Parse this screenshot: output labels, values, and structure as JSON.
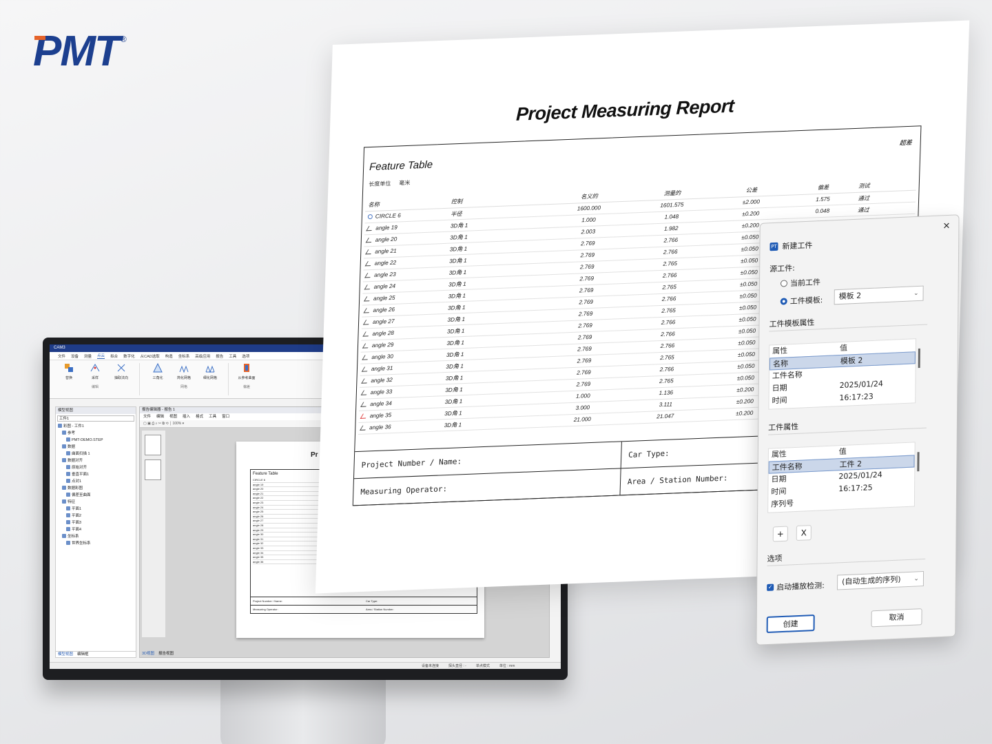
{
  "brand": {
    "name": "PMT",
    "reg": "®",
    "color": "#1c3f8f",
    "accent": "#e5632a"
  },
  "monitor": {
    "app_title": "CAM3",
    "menu": [
      "文件",
      "设备",
      "测量",
      "点云",
      "拟合",
      "数字化",
      "从CAD选取",
      "构造",
      "坐标系",
      "高级应用",
      "报告",
      "工具",
      "选项"
    ],
    "ribbon": {
      "group1": {
        "items": [
          "替换",
          "采样",
          "抽取法向"
        ],
        "label": "编辑"
      },
      "group2": {
        "items": [
          "三角化",
          "简化网格",
          "细化网格"
        ],
        "label": "网格"
      },
      "group3": {
        "items": [
          "从参考曲面"
        ],
        "label": "偏差"
      }
    },
    "left_panel": {
      "title": "模型视图",
      "select": "工件1",
      "tree": [
        "彩图 - 工件1",
        "参考",
        "PMT-DEMO.STEP",
        "数据",
        "曲面扫描 1",
        "数据对齐",
        "原始对齐",
        "垂直平面1",
        "点对1",
        "数据彩图",
        "偏差至曲面",
        "特征",
        "平面1",
        "平面2",
        "平面3",
        "平面4",
        "坐标系",
        "世界坐标系"
      ],
      "tabs": [
        "模型视图",
        "编辑框"
      ]
    },
    "report_editor": {
      "title": "报告编辑器 - 报告 1",
      "menu": [
        "文件",
        "编辑",
        "视图",
        "插入",
        "格式",
        "工具",
        "窗口"
      ],
      "zoom": "100%",
      "mini_heading": "Pr",
      "mini_table_title": "Feature Table",
      "mini_rows": [
        "CIRCLE 6",
        "angle 19",
        "angle 20",
        "angle 21",
        "angle 22",
        "angle 23",
        "angle 24",
        "angle 25",
        "angle 26",
        "angle 27",
        "angle 28",
        "angle 29",
        "angle 30",
        "angle 31",
        "angle 32",
        "angle 33",
        "angle 34",
        "angle 35",
        "angle 36"
      ],
      "mini_foot": [
        "Project Number / Name:",
        "Car Type:",
        "Measuring Operator:",
        "Area / Station Number:"
      ],
      "tabs": [
        "3D视图",
        "报告视图"
      ]
    },
    "status": [
      "设备未连接",
      "探头直径 : -",
      "单点模式",
      "单位 : mm"
    ]
  },
  "report": {
    "title": "Project Measuring Report",
    "table_title": "Feature Table",
    "unit_label": "长度单位",
    "unit_value": "毫米",
    "over_label": "超差",
    "headers": [
      "名称",
      "控制",
      "名义的",
      "测量的",
      "公差",
      "偏差",
      "测试"
    ],
    "rows": [
      {
        "name": "CIRCLE 6",
        "ctrl": "半径",
        "nom": "1600.000",
        "meas": "1601.575",
        "tol": "±2.000",
        "dev": "1.575",
        "test": "通过",
        "icon": "circle"
      },
      {
        "name": "angle 19",
        "ctrl": "3D角 1",
        "nom": "1.000",
        "meas": "1.048",
        "tol": "±0.200",
        "dev": "0.048",
        "test": "通过",
        "icon": "angle"
      },
      {
        "name": "angle 20",
        "ctrl": "3D角 1",
        "nom": "2.003",
        "meas": "1.982",
        "tol": "±0.200",
        "dev": "-0.021",
        "test": "通过",
        "icon": "angle"
      },
      {
        "name": "angle 21",
        "ctrl": "3D角 1",
        "nom": "2.769",
        "meas": "2.766",
        "tol": "±0.050",
        "dev": "-0.003",
        "test": "通过",
        "icon": "angle"
      },
      {
        "name": "angle 22",
        "ctrl": "3D角 1",
        "nom": "2.769",
        "meas": "2.766",
        "tol": "±0.050",
        "dev": "-0.003",
        "test": "通过",
        "icon": "angle"
      },
      {
        "name": "angle 23",
        "ctrl": "3D角 1",
        "nom": "2.769",
        "meas": "2.765",
        "tol": "±0.050",
        "dev": "-0.004",
        "test": "",
        "icon": "angle"
      },
      {
        "name": "angle 24",
        "ctrl": "3D角 1",
        "nom": "2.769",
        "meas": "2.766",
        "tol": "±0.050",
        "dev": "-0.003",
        "test": "",
        "icon": "angle"
      },
      {
        "name": "angle 25",
        "ctrl": "3D角 1",
        "nom": "2.769",
        "meas": "2.765",
        "tol": "±0.050",
        "dev": "-0.004",
        "test": "",
        "icon": "angle"
      },
      {
        "name": "angle 26",
        "ctrl": "3D角 1",
        "nom": "2.769",
        "meas": "2.766",
        "tol": "±0.050",
        "dev": "-0.003",
        "test": "",
        "icon": "angle"
      },
      {
        "name": "angle 27",
        "ctrl": "3D角 1",
        "nom": "2.769",
        "meas": "2.765",
        "tol": "±0.050",
        "dev": "-0.004",
        "test": "",
        "icon": "angle"
      },
      {
        "name": "angle 28",
        "ctrl": "3D角 1",
        "nom": "2.769",
        "meas": "2.766",
        "tol": "±0.050",
        "dev": "-0.003",
        "test": "",
        "icon": "angle"
      },
      {
        "name": "angle 29",
        "ctrl": "3D角 1",
        "nom": "2.769",
        "meas": "2.766",
        "tol": "±0.050",
        "dev": "-0.003",
        "test": "",
        "icon": "angle"
      },
      {
        "name": "angle 30",
        "ctrl": "3D角 1",
        "nom": "2.769",
        "meas": "2.766",
        "tol": "±0.050",
        "dev": "-0.003",
        "test": "",
        "icon": "angle"
      },
      {
        "name": "angle 31",
        "ctrl": "3D角 1",
        "nom": "2.769",
        "meas": "2.765",
        "tol": "±0.050",
        "dev": "-0.004",
        "test": "",
        "icon": "angle"
      },
      {
        "name": "angle 32",
        "ctrl": "3D角 1",
        "nom": "2.769",
        "meas": "2.766",
        "tol": "±0.050",
        "dev": "-0.003",
        "test": "",
        "icon": "angle"
      },
      {
        "name": "angle 33",
        "ctrl": "3D角 1",
        "nom": "2.769",
        "meas": "2.765",
        "tol": "±0.050",
        "dev": "-0.004",
        "test": "",
        "icon": "angle"
      },
      {
        "name": "angle 34",
        "ctrl": "3D角 1",
        "nom": "1.000",
        "meas": "1.136",
        "tol": "±0.200",
        "dev": "0.136",
        "test": "",
        "icon": "angle"
      },
      {
        "name": "angle 35",
        "ctrl": "3D角 1",
        "nom": "3.000",
        "meas": "3.111",
        "tol": "±0.200",
        "dev": "0.111",
        "test": "",
        "icon": "angle-red"
      },
      {
        "name": "angle 36",
        "ctrl": "3D角 1",
        "nom": "21.000",
        "meas": "21.047",
        "tol": "±0.200",
        "dev": "0.047",
        "test": "",
        "icon": "angle"
      }
    ],
    "footer": {
      "project": "Project Number / Name:",
      "car_type": "Car Type:",
      "operator": "Measuring Operator:",
      "area": "Area / Station Number:"
    }
  },
  "dialog": {
    "title": "新建工件",
    "source_label": "源工件:",
    "radio_current": "当前工件",
    "radio_template": "工件模板:",
    "template_value": "模板 2",
    "template_props_label": "工件模板属性",
    "template_props": {
      "head": [
        "属性",
        "值"
      ],
      "rows": [
        {
          "k": "名称",
          "v": "模板 2"
        },
        {
          "k": "工件名称",
          "v": ""
        },
        {
          "k": "日期",
          "v": "2025/01/24"
        },
        {
          "k": "时间",
          "v": "16:17:23"
        }
      ]
    },
    "work_props_label": "工件属性",
    "work_props": {
      "head": [
        "属性",
        "值"
      ],
      "rows": [
        {
          "k": "工件名称",
          "v": "工件 2"
        },
        {
          "k": "日期",
          "v": "2025/01/24"
        },
        {
          "k": "时间",
          "v": "16:17:25"
        },
        {
          "k": "序列号",
          "v": ""
        }
      ]
    },
    "add_label": "+",
    "remove_label": "X",
    "options_label": "选项",
    "auto_check_label": "启动播放检测:",
    "auto_check_value": "(自动生成的序列)",
    "create_label": "创建",
    "cancel_label": "取消"
  }
}
